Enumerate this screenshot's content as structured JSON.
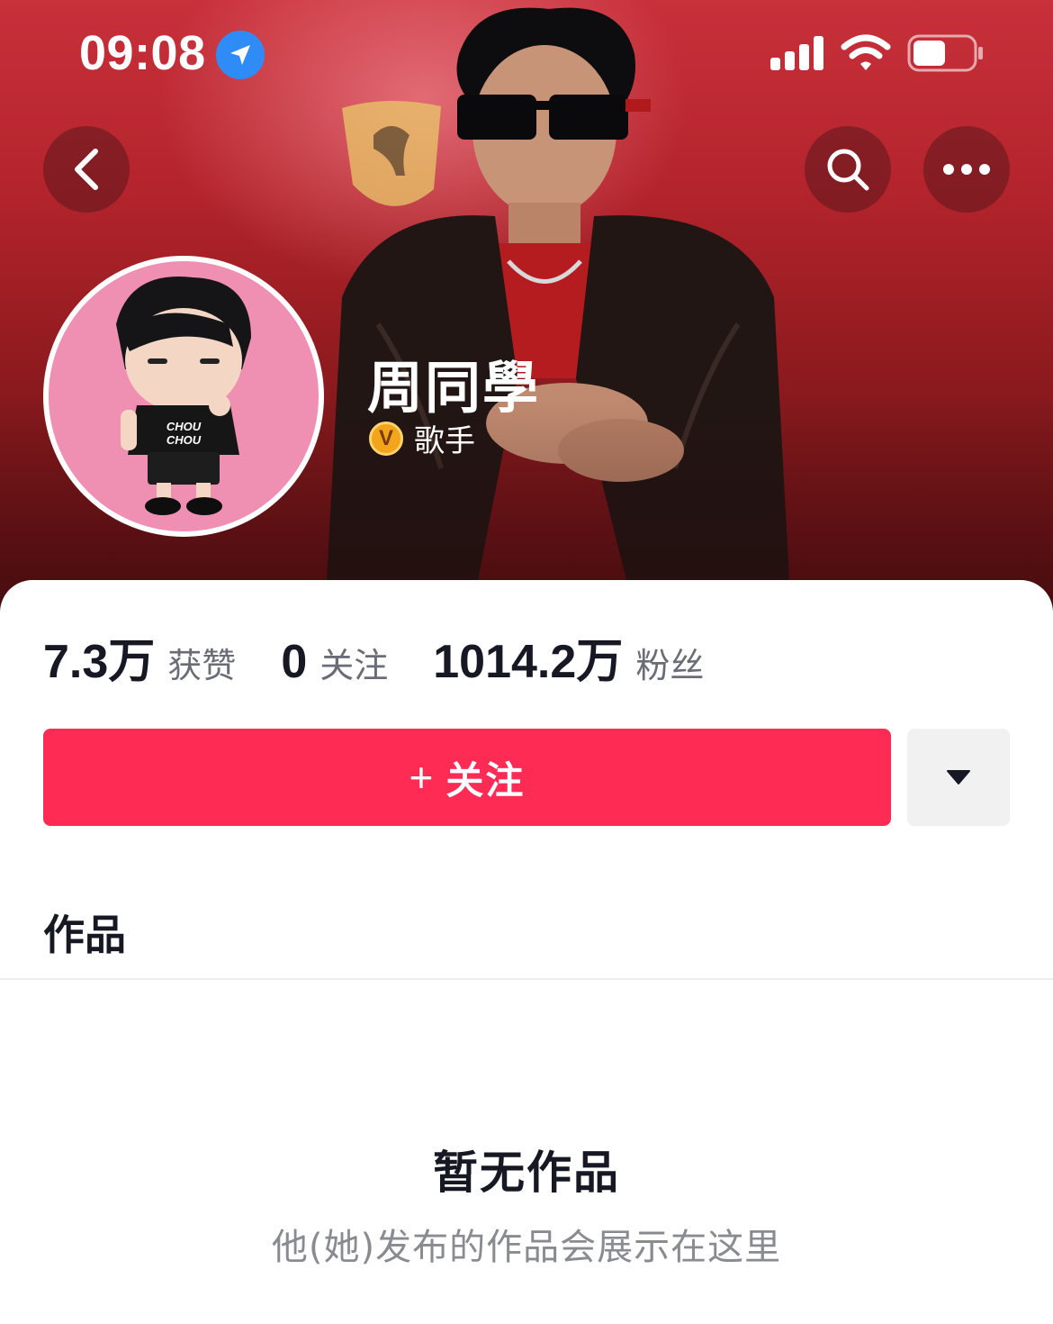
{
  "status_bar": {
    "time": "09:08",
    "location_icon": "location-arrow-icon",
    "signal_icon": "cellular-signal-icon",
    "wifi_icon": "wifi-icon",
    "battery_icon": "battery-icon",
    "battery_level": 0.55
  },
  "header": {
    "back_icon": "chevron-left-icon",
    "search_icon": "search-icon",
    "more_icon": "more-horizontal-icon"
  },
  "profile": {
    "nickname": "周同學",
    "verify_badge": "V",
    "verify_label": "歌手"
  },
  "stats": [
    {
      "value": "7.3万",
      "label": "获赞"
    },
    {
      "value": "0",
      "label": "关注"
    },
    {
      "value": "1014.2万",
      "label": "粉丝"
    }
  ],
  "actions": {
    "follow_plus": "+",
    "follow_label": "关注",
    "dropdown_icon": "caret-down-icon"
  },
  "tabs": {
    "works": "作品"
  },
  "empty_state": {
    "title": "暂无作品",
    "subtitle": "他(她)发布的作品会展示在这里"
  },
  "colors": {
    "accent": "#fe2c55",
    "cover_top": "#c8303a",
    "cover_bottom": "#581012",
    "avatar_bg": "#ef8fb2",
    "verify_gold": "#f2a51c",
    "text_primary": "#161823",
    "text_secondary": "#6b6d76"
  }
}
